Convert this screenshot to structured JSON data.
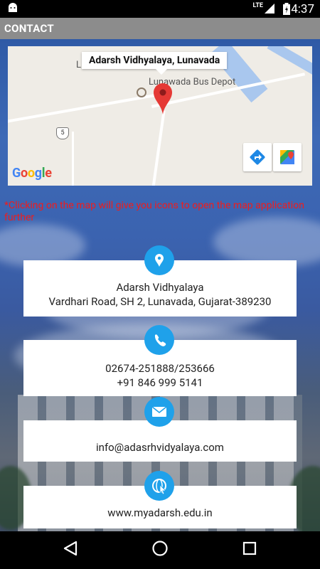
{
  "status_bar": {
    "time": "4:37",
    "network": "LTE"
  },
  "app_bar": {
    "title": "CONTACT"
  },
  "map": {
    "info_window_title": "Adarsh Vidhyalaya, Lunavada",
    "place_label": "Lunawada Bus Depot",
    "partial_label": "L",
    "route_shield": "5",
    "brand": "Google"
  },
  "note": "*Clicking on the map will give you icons to open the map application further",
  "contacts": {
    "address": {
      "line1": "Adarsh Vidhyalaya",
      "line2": "Vardhari Road, SH 2, Lunavada, Gujarat-389230",
      "icon": "location-pin-icon"
    },
    "phone": {
      "line1": "02674-251888/253666",
      "line2": "+91 846 999 5141",
      "icon": "phone-icon"
    },
    "email": {
      "line1": "info@adasrhvidyalaya.com",
      "icon": "mail-icon"
    },
    "website": {
      "line1": "www.myadarsh.edu.in",
      "icon": "web-icon"
    }
  },
  "colors": {
    "accent": "#1fa1ea",
    "note": "#f01c1c",
    "appbar": "#8c8c8c"
  }
}
